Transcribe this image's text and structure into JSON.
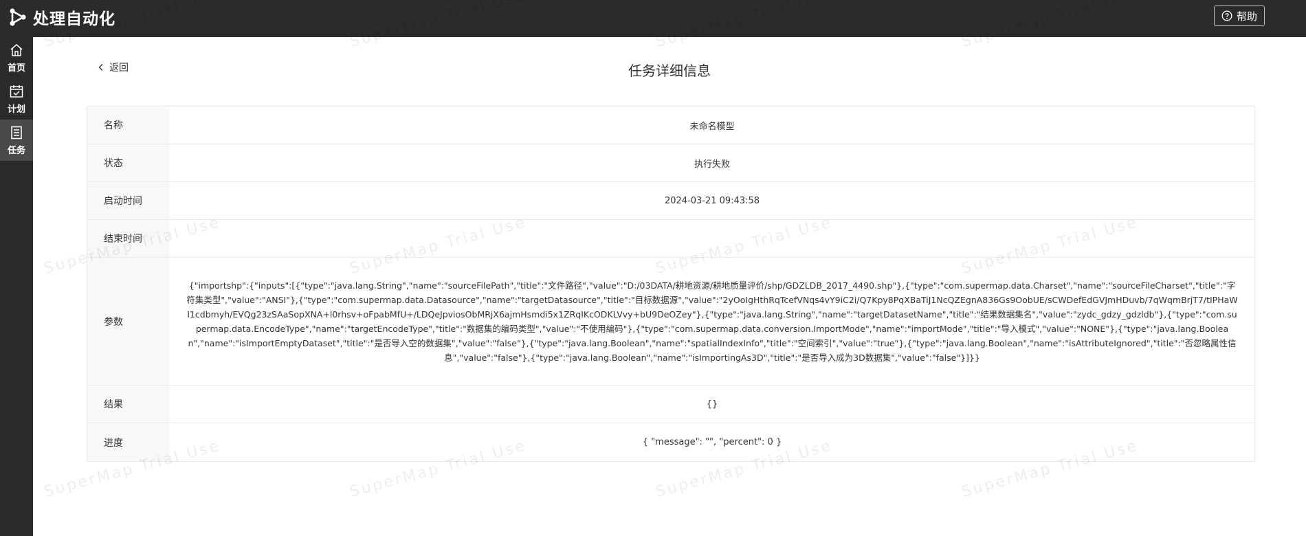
{
  "app": {
    "title": "处理自动化",
    "help_label": "帮助"
  },
  "sidebar": {
    "items": [
      {
        "label": "首页",
        "icon": "home-icon"
      },
      {
        "label": "计划",
        "icon": "calendar-icon"
      },
      {
        "label": "任务",
        "icon": "task-list-icon"
      }
    ],
    "active": "任务"
  },
  "page": {
    "back_label": "返回",
    "title": "任务详细信息"
  },
  "details": {
    "rows": [
      {
        "label": "名称",
        "value": "未命名模型"
      },
      {
        "label": "状态",
        "value": "执行失败"
      },
      {
        "label": "启动时间",
        "value": "2024-03-21 09:43:58"
      },
      {
        "label": "结束时间",
        "value": ""
      },
      {
        "label": "参数",
        "value": "{\"importshp\":{\"inputs\":[{\"type\":\"java.lang.String\",\"name\":\"sourceFilePath\",\"title\":\"文件路径\",\"value\":\"D:/03DATA/耕地资源/耕地质量评价/shp/GDZLDB_2017_4490.shp\"},{\"type\":\"com.supermap.data.Charset\",\"name\":\"sourceFileCharset\",\"title\":\"字符集类型\",\"value\":\"ANSI\"},{\"type\":\"com.supermap.data.Datasource\",\"name\":\"targetDatasource\",\"title\":\"目标数据源\",\"value\":\"2yOoIgHthRqTcefVNqs4vY9iC2i/Q7Kpy8PqXBaTiJ1NcQZEgnA836Gs9OobUE/sCWDefEdGVJmHDuvb/7qWqmBrjT7/tIPHaWI1cdbmyh/EVQg23zSAaSopXNA+l0rhsv+oFpabMfU+/LDQeJpviosObMRjX6ajmHsmdi5x1ZRqIKcODKLVvy+bU9DeOZey\"},{\"type\":\"java.lang.String\",\"name\":\"targetDatasetName\",\"title\":\"结果数据集名\",\"value\":\"zydc_gdzy_gdzldb\"},{\"type\":\"com.supermap.data.EncodeType\",\"name\":\"targetEncodeType\",\"title\":\"数据集的编码类型\",\"value\":\"不使用编码\"},{\"type\":\"com.supermap.data.conversion.ImportMode\",\"name\":\"importMode\",\"title\":\"导入模式\",\"value\":\"NONE\"},{\"type\":\"java.lang.Boolean\",\"name\":\"isImportEmptyDataset\",\"title\":\"是否导入空的数据集\",\"value\":\"false\"},{\"type\":\"java.lang.Boolean\",\"name\":\"spatialIndexInfo\",\"title\":\"空间索引\",\"value\":\"true\"},{\"type\":\"java.lang.Boolean\",\"name\":\"isAttributeIgnored\",\"title\":\"否忽略属性信息\",\"value\":\"false\"},{\"type\":\"java.lang.Boolean\",\"name\":\"isImportingAs3D\",\"title\":\"是否导入成为3D数据集\",\"value\":\"false\"}]}}"
      },
      {
        "label": "结果",
        "value": "{}"
      },
      {
        "label": "进度",
        "value": "{ \"message\": \"\", \"percent\": 0 }"
      }
    ]
  },
  "watermark": {
    "text": "SuperMap Trial Use"
  },
  "colors": {
    "topbar": "#2b2b2b",
    "sidebar_active": "#4a4a4a",
    "label_bg": "#f8f8f8",
    "border": "#eaeaea"
  }
}
